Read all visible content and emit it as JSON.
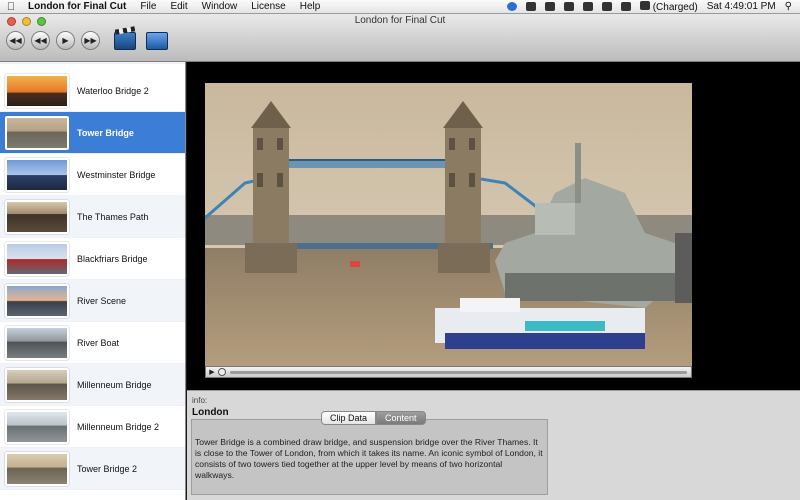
{
  "menubar": {
    "app_name": "London for Final Cut",
    "menus": [
      "File",
      "Edit",
      "Window",
      "License",
      "Help"
    ],
    "battery": "(Charged)",
    "clock": "Sat 4:49:01 PM"
  },
  "window": {
    "title": "London for Final Cut"
  },
  "toolbar": {
    "buttons": [
      "previous-button",
      "rewind-button",
      "play-button",
      "fast-forward-button",
      "clapper-tool-button",
      "screen-tool-button"
    ]
  },
  "clips": [
    {
      "label": "Waterloo Bridge 2"
    },
    {
      "label": "Tower Bridge",
      "selected": true
    },
    {
      "label": "Westminster Bridge"
    },
    {
      "label": "The Thames Path"
    },
    {
      "label": "Blackfriars Bridge"
    },
    {
      "label": "River Scene"
    },
    {
      "label": "River Boat"
    },
    {
      "label": "Millenneum Bridge"
    },
    {
      "label": "Millenneum Bridge 2"
    },
    {
      "label": "Tower Bridge 2"
    }
  ],
  "info": {
    "label": "info:",
    "title": "London",
    "tabs": [
      "Clip Data",
      "Content"
    ],
    "active_tab": "Clip Data",
    "description": "Tower Bridge is a combined draw bridge, and suspension bridge over the River Thames. It is close to the Tower of London, from which it takes its name. An iconic symbol of London, it consists of two towers tied together at the upper level by means of two horizontal walkways."
  },
  "colors": {
    "selection": "#3c7ed6",
    "info_panel": "#d8d8d8"
  }
}
